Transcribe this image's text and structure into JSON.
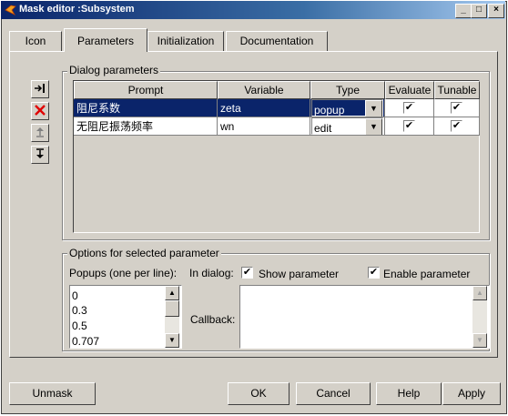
{
  "window": {
    "title": "Mask editor :Subsystem",
    "caption_buttons": [
      "minimize-icon",
      "maximize-icon",
      "close-icon"
    ]
  },
  "tabs": [
    {
      "label": "Icon",
      "active": false
    },
    {
      "label": "Parameters",
      "active": true
    },
    {
      "label": "Initialization",
      "active": false
    },
    {
      "label": "Documentation",
      "active": false
    }
  ],
  "dialog_parameters": {
    "legend": "Dialog parameters",
    "side_buttons": [
      "add-parameter-icon",
      "delete-parameter-icon",
      "move-up-icon",
      "move-down-icon"
    ],
    "columns": [
      "Prompt",
      "Variable",
      "Type",
      "Evaluate",
      "Tunable"
    ],
    "rows": [
      {
        "prompt": "阻尼系数",
        "variable": "zeta",
        "type": "popup",
        "evaluate": true,
        "tunable": true,
        "selected": true
      },
      {
        "prompt": "无阻尼振荡频率",
        "variable": "wn",
        "type": "edit",
        "evaluate": true,
        "tunable": true,
        "selected": false
      }
    ]
  },
  "options": {
    "legend": "Options for selected parameter",
    "popups_label": "Popups (one per line):",
    "in_dialog_label": "In dialog:",
    "show_parameter_label": "Show parameter",
    "show_parameter_checked": true,
    "enable_parameter_label": "Enable parameter",
    "enable_parameter_checked": true,
    "popup_values": [
      "0",
      "0.3",
      "0.5",
      "0.707"
    ],
    "callback_label": "Callback:",
    "callback_value": ""
  },
  "footer": {
    "unmask": "Unmask",
    "ok": "OK",
    "cancel": "Cancel",
    "help": "Help",
    "apply": "Apply"
  }
}
